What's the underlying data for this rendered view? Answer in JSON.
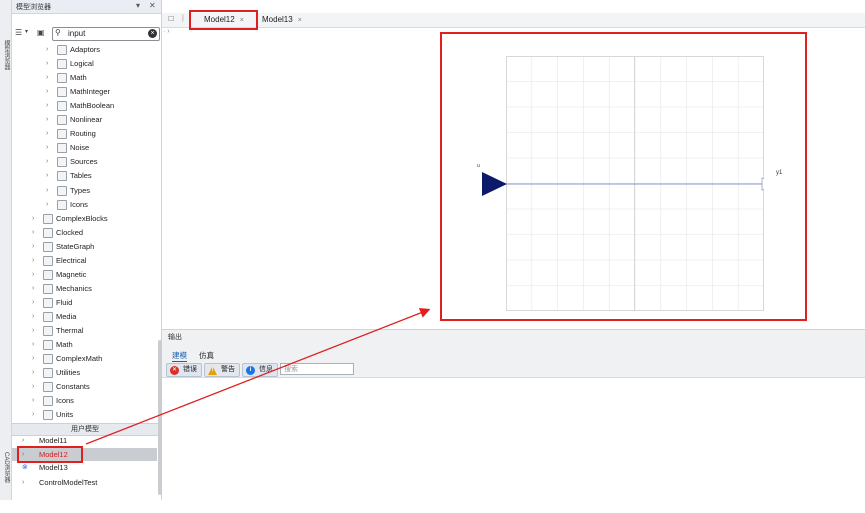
{
  "left_strip": {
    "tab_model_browser": "模型浏览器",
    "tab_cad_browser": "CAD浏览器"
  },
  "model_browser": {
    "title": "模型浏览器",
    "search_value": "input",
    "tree": [
      {
        "label": "Adaptors",
        "level": 2,
        "selected": false
      },
      {
        "label": "Logical",
        "level": 2,
        "selected": false
      },
      {
        "label": "Math",
        "level": 2,
        "selected": false
      },
      {
        "label": "MathInteger",
        "level": 2,
        "selected": false
      },
      {
        "label": "MathBoolean",
        "level": 2,
        "selected": false
      },
      {
        "label": "Nonlinear",
        "level": 2,
        "selected": false
      },
      {
        "label": "Routing",
        "level": 2,
        "selected": false
      },
      {
        "label": "Noise",
        "level": 2,
        "selected": false
      },
      {
        "label": "Sources",
        "level": 2,
        "selected": false
      },
      {
        "label": "Tables",
        "level": 2,
        "selected": false
      },
      {
        "label": "Types",
        "level": 2,
        "selected": false
      },
      {
        "label": "Icons",
        "level": 2,
        "selected": false
      },
      {
        "label": "ComplexBlocks",
        "level": 1,
        "selected": false
      },
      {
        "label": "Clocked",
        "level": 1,
        "selected": false
      },
      {
        "label": "StateGraph",
        "level": 1,
        "selected": false
      },
      {
        "label": "Electrical",
        "level": 1,
        "selected": false
      },
      {
        "label": "Magnetic",
        "level": 1,
        "selected": false
      },
      {
        "label": "Mechanics",
        "level": 1,
        "selected": false
      },
      {
        "label": "Fluid",
        "level": 1,
        "selected": false
      },
      {
        "label": "Media",
        "level": 1,
        "selected": false
      },
      {
        "label": "Thermal",
        "level": 1,
        "selected": false
      },
      {
        "label": "Math",
        "level": 1,
        "selected": false
      },
      {
        "label": "ComplexMath",
        "level": 1,
        "selected": false
      },
      {
        "label": "Utilities",
        "level": 1,
        "selected": false
      },
      {
        "label": "Constants",
        "level": 1,
        "selected": false
      },
      {
        "label": "Icons",
        "level": 1,
        "selected": false
      },
      {
        "label": "Units",
        "level": 1,
        "selected": false
      }
    ],
    "user_models_header": "用户模型",
    "user_models": [
      {
        "label": "Model11",
        "selected": false
      },
      {
        "label": "Model12",
        "selected": true
      },
      {
        "label": "Model13",
        "selected": false
      },
      {
        "label": "ControlModelTest",
        "selected": false
      }
    ]
  },
  "tabs": [
    {
      "label": "Model12",
      "active": true
    },
    {
      "label": "Model13",
      "active": false
    }
  ],
  "breadcrumb": "· ›",
  "diagram": {
    "input_label": "u",
    "output_label": "y1"
  },
  "output": {
    "title": "输出",
    "tabs": [
      "建模",
      "仿真"
    ],
    "filters": [
      {
        "label": "错误",
        "icon": "error-icon",
        "color": "#d93025"
      },
      {
        "label": "警告",
        "icon": "warning-icon",
        "color": "#e8a100"
      },
      {
        "label": "信息",
        "icon": "info-icon",
        "color": "#1a73e8"
      }
    ],
    "search_placeholder": "搜索"
  },
  "colors": {
    "highlight_red": "#e02020",
    "block_navy": "#0d1a6b",
    "connector_line": "#8a93c9"
  }
}
